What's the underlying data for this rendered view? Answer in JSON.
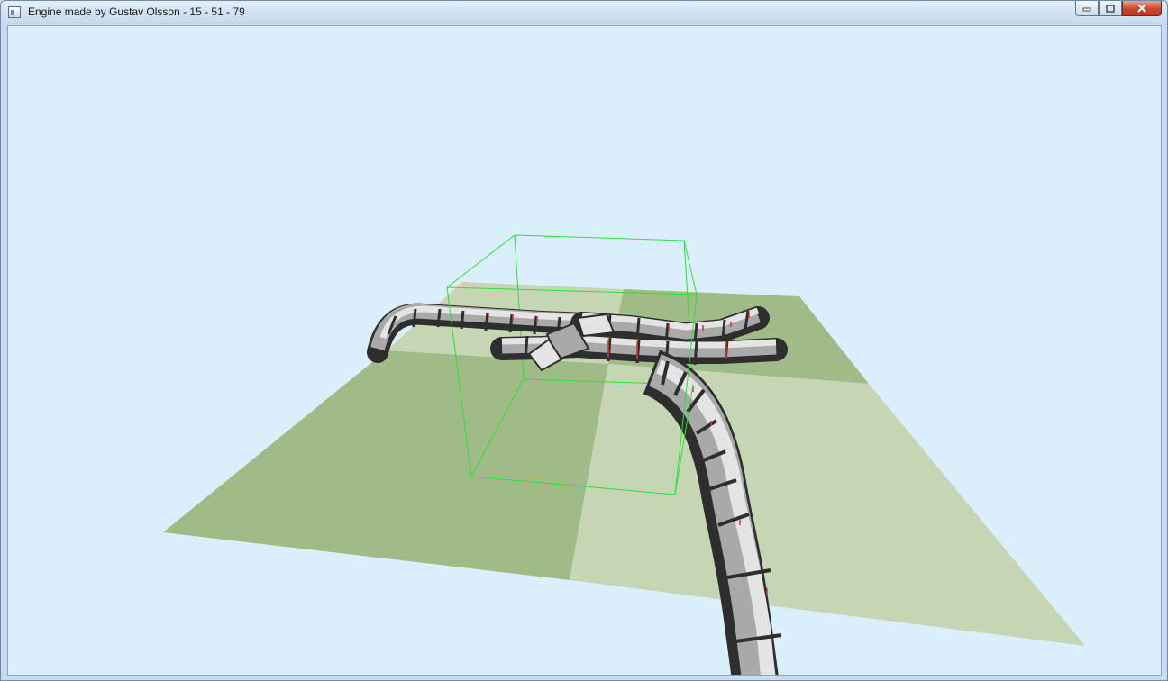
{
  "window": {
    "title": "Engine made by Gustav Olsson - 15 - 51 - 79",
    "app_icon": "window-app-icon",
    "controls": {
      "minimize_icon": "minimize-icon",
      "maximize_icon": "maximize-icon",
      "close_icon": "close-icon"
    }
  },
  "scene": {
    "background_color": "#dbeefc",
    "ground_colors": {
      "dark": "#a0bb87",
      "light": "#c6d6b5"
    },
    "bounding_box_color": "#2ee03a",
    "segment_colors": {
      "light": "#e4e4e4",
      "mid": "#a9a9a9",
      "dark": "#2e2e2e"
    },
    "joint_marker_color": "#e03030"
  }
}
